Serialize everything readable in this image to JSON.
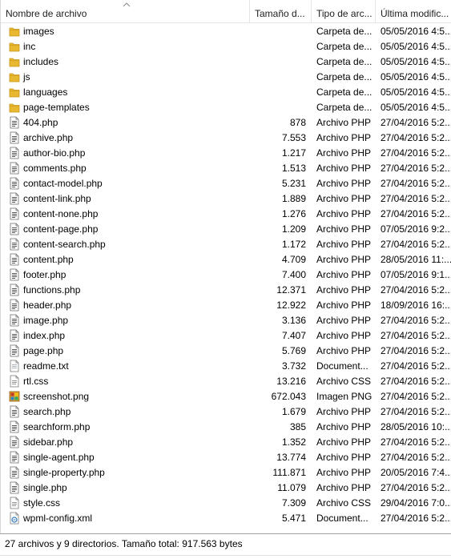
{
  "columns": {
    "name": "Nombre de archivo",
    "size": "Tamaño d...",
    "type": "Tipo de arc...",
    "date": "Última modific..."
  },
  "files": [
    {
      "name": "images",
      "size": "",
      "type": "Carpeta de...",
      "date": "05/05/2016 4:5...",
      "icon": "folder"
    },
    {
      "name": "inc",
      "size": "",
      "type": "Carpeta de...",
      "date": "05/05/2016 4:5...",
      "icon": "folder"
    },
    {
      "name": "includes",
      "size": "",
      "type": "Carpeta de...",
      "date": "05/05/2016 4:5...",
      "icon": "folder"
    },
    {
      "name": "js",
      "size": "",
      "type": "Carpeta de...",
      "date": "05/05/2016 4:5...",
      "icon": "folder"
    },
    {
      "name": "languages",
      "size": "",
      "type": "Carpeta de...",
      "date": "05/05/2016 4:5...",
      "icon": "folder"
    },
    {
      "name": "page-templates",
      "size": "",
      "type": "Carpeta de...",
      "date": "05/05/2016 4:5...",
      "icon": "folder"
    },
    {
      "name": "404.php",
      "size": "878",
      "type": "Archivo PHP",
      "date": "27/04/2016 5:2...",
      "icon": "php"
    },
    {
      "name": "archive.php",
      "size": "7.553",
      "type": "Archivo PHP",
      "date": "27/04/2016 5:2...",
      "icon": "php"
    },
    {
      "name": "author-bio.php",
      "size": "1.217",
      "type": "Archivo PHP",
      "date": "27/04/2016 5:2...",
      "icon": "php"
    },
    {
      "name": "comments.php",
      "size": "1.513",
      "type": "Archivo PHP",
      "date": "27/04/2016 5:2...",
      "icon": "php"
    },
    {
      "name": "contact-model.php",
      "size": "5.231",
      "type": "Archivo PHP",
      "date": "27/04/2016 5:2...",
      "icon": "php"
    },
    {
      "name": "content-link.php",
      "size": "1.889",
      "type": "Archivo PHP",
      "date": "27/04/2016 5:2...",
      "icon": "php"
    },
    {
      "name": "content-none.php",
      "size": "1.276",
      "type": "Archivo PHP",
      "date": "27/04/2016 5:2...",
      "icon": "php"
    },
    {
      "name": "content-page.php",
      "size": "1.209",
      "type": "Archivo PHP",
      "date": "07/05/2016 9:2...",
      "icon": "php"
    },
    {
      "name": "content-search.php",
      "size": "1.172",
      "type": "Archivo PHP",
      "date": "27/04/2016 5:2...",
      "icon": "php"
    },
    {
      "name": "content.php",
      "size": "4.709",
      "type": "Archivo PHP",
      "date": "28/05/2016 11:...",
      "icon": "php"
    },
    {
      "name": "footer.php",
      "size": "7.400",
      "type": "Archivo PHP",
      "date": "07/05/2016 9:1...",
      "icon": "php"
    },
    {
      "name": "functions.php",
      "size": "12.371",
      "type": "Archivo PHP",
      "date": "27/04/2016 5:2...",
      "icon": "php"
    },
    {
      "name": "header.php",
      "size": "12.922",
      "type": "Archivo PHP",
      "date": "18/09/2016 16:...",
      "icon": "php"
    },
    {
      "name": "image.php",
      "size": "3.136",
      "type": "Archivo PHP",
      "date": "27/04/2016 5:2...",
      "icon": "php"
    },
    {
      "name": "index.php",
      "size": "7.407",
      "type": "Archivo PHP",
      "date": "27/04/2016 5:2...",
      "icon": "php"
    },
    {
      "name": "page.php",
      "size": "5.769",
      "type": "Archivo PHP",
      "date": "27/04/2016 5:2...",
      "icon": "php"
    },
    {
      "name": "readme.txt",
      "size": "3.732",
      "type": "Document...",
      "date": "27/04/2016 5:2...",
      "icon": "txt"
    },
    {
      "name": "rtl.css",
      "size": "13.216",
      "type": "Archivo CSS",
      "date": "27/04/2016 5:2...",
      "icon": "css"
    },
    {
      "name": "screenshot.png",
      "size": "672.043",
      "type": "Imagen PNG",
      "date": "27/04/2016 5:2...",
      "icon": "png"
    },
    {
      "name": "search.php",
      "size": "1.679",
      "type": "Archivo PHP",
      "date": "27/04/2016 5:2...",
      "icon": "php"
    },
    {
      "name": "searchform.php",
      "size": "385",
      "type": "Archivo PHP",
      "date": "28/05/2016 10:...",
      "icon": "php"
    },
    {
      "name": "sidebar.php",
      "size": "1.352",
      "type": "Archivo PHP",
      "date": "27/04/2016 5:2...",
      "icon": "php"
    },
    {
      "name": "single-agent.php",
      "size": "13.774",
      "type": "Archivo PHP",
      "date": "27/04/2016 5:2...",
      "icon": "php"
    },
    {
      "name": "single-property.php",
      "size": "111.871",
      "type": "Archivo PHP",
      "date": "20/05/2016 7:4...",
      "icon": "php"
    },
    {
      "name": "single.php",
      "size": "11.079",
      "type": "Archivo PHP",
      "date": "27/04/2016 5:2...",
      "icon": "php"
    },
    {
      "name": "style.css",
      "size": "7.309",
      "type": "Archivo CSS",
      "date": "29/04/2016 7:0...",
      "icon": "css"
    },
    {
      "name": "wpml-config.xml",
      "size": "5.471",
      "type": "Document...",
      "date": "27/04/2016 5:2...",
      "icon": "xml"
    }
  ],
  "status": "27 archivos y 9 directorios. Tamaño total: 917.563 bytes",
  "colors": {
    "folder": "#e8b830",
    "folder_dark": "#c8961a",
    "border": "#e5e5e5"
  }
}
